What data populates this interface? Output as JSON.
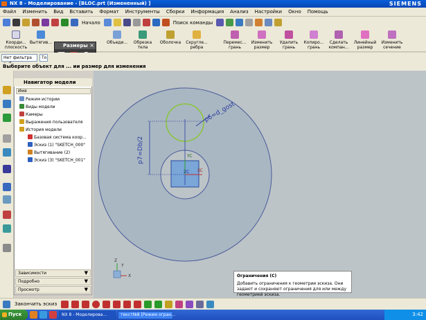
{
  "window": {
    "title": "NX 8 - Моделирование - [BLOC.prt (Измененный) ]",
    "brand": "SIEMENS"
  },
  "menu": [
    "Файл",
    "Изменить",
    "Вид",
    "Вставить",
    "Формат",
    "Инструменты",
    "Сборки",
    "Информация",
    "Анализ",
    "Настройки",
    "Окно",
    "Помощь"
  ],
  "toolbar1": {
    "start_label": "Начало",
    "command_search": "Поиск команды"
  },
  "toolbar2": {
    "buttons": [
      "Коорди... плоскость",
      "Вытягив...",
      "Объеди...",
      "Обрезка тела",
      "Оболочка",
      "Скругле... ребра",
      "Перемес... грань",
      "Изменить размер",
      "Удалить грань",
      "Копиро... грань",
      "Сделать компан...",
      "Линейный размер",
      "Изменить сечение"
    ]
  },
  "popup": {
    "title": "Размеры"
  },
  "toolbar3": {
    "filter": "Нет фильтра выб",
    "selection": "То"
  },
  "cue_line": "Выберите объект для ... ии размер для изменения",
  "navigator": {
    "title": "Навигатор модели",
    "column": "Имя",
    "items": [
      {
        "label": "Режим истории",
        "indent": 0,
        "color": "#6b8fc7"
      },
      {
        "label": "Виды модели",
        "indent": 0,
        "color": "#3a8a3a"
      },
      {
        "label": "Камеры",
        "indent": 0,
        "color": "#c04040"
      },
      {
        "label": "Выражения пользователя",
        "indent": 0,
        "color": "#d0a020"
      },
      {
        "label": "История модели",
        "indent": 0,
        "color": "#d0a020"
      },
      {
        "label": "Базовая система коор...",
        "indent": 1,
        "color": "#d03030"
      },
      {
        "label": "Эскиз (1) \"SKETCH_000\"",
        "indent": 1,
        "color": "#3060c0"
      },
      {
        "label": "Вытягивание (2)",
        "indent": 1,
        "color": "#d08020"
      },
      {
        "label": "Эскиз (3) \"SKETCH_001\"",
        "indent": 1,
        "color": "#3060c0"
      }
    ],
    "panels": [
      "Зависимости",
      "Подробно",
      "Просмотр"
    ]
  },
  "sketch": {
    "dims": [
      "p7=Db/2",
      "p6=d_gost"
    ],
    "axis_labels": [
      "YC",
      "XC",
      "ZC"
    ],
    "triad": [
      "Z",
      "Y",
      "X"
    ]
  },
  "tooltip": {
    "title": "Ограничения (C)",
    "text": "Добавить ограничения к геометрии эскиза. Они задают и сохраняют ограничения для или между геометрией эскиза."
  },
  "sketchbar": {
    "finish_label": "Закончить эскиз"
  },
  "taskbar": {
    "start": "Пуск",
    "tasks": [
      "NX 8 - Моделирова...",
      "текст№8 [Режим огран..."
    ],
    "clock": "3:42"
  },
  "colors": {
    "titlebar": "#0846b5",
    "canvas_bg": "#bcc4c8",
    "disc": "#a9b7c2",
    "dimension": "#2a3aa0",
    "green_circle": "#8ac43a"
  }
}
